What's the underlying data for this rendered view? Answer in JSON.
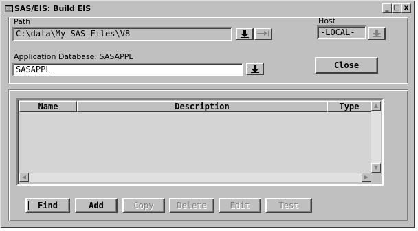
{
  "window": {
    "title": "SAS/EIS: Build EIS",
    "sys_icon_text": "EIS",
    "caption_buttons": [
      "_",
      "□",
      "x"
    ]
  },
  "path": {
    "label": "Path",
    "value": "C:\\data\\My SAS Files\\V8"
  },
  "host": {
    "label": "Host",
    "value": "-LOCAL-"
  },
  "app_db": {
    "label": "Application Database: SASAPPL",
    "value": "SASAPPL"
  },
  "close_button": "Close",
  "table": {
    "columns": [
      "Name",
      "Description",
      "Type"
    ],
    "rows": []
  },
  "actions": [
    {
      "label": "Find",
      "enabled": true
    },
    {
      "label": "Add",
      "enabled": true
    },
    {
      "label": "Copy",
      "enabled": false
    },
    {
      "label": "Delete",
      "enabled": false
    },
    {
      "label": "Edit",
      "enabled": false
    },
    {
      "label": "Test",
      "enabled": false
    }
  ],
  "icons": {
    "path_down": "arrow-down-icon",
    "path_go": "arrow-right-icon",
    "host_down": "arrow-down-icon",
    "app_down": "arrow-down-icon"
  },
  "colors": {
    "face": "#c0c0c0",
    "shadow": "#808080",
    "highlight": "#ffffff"
  }
}
